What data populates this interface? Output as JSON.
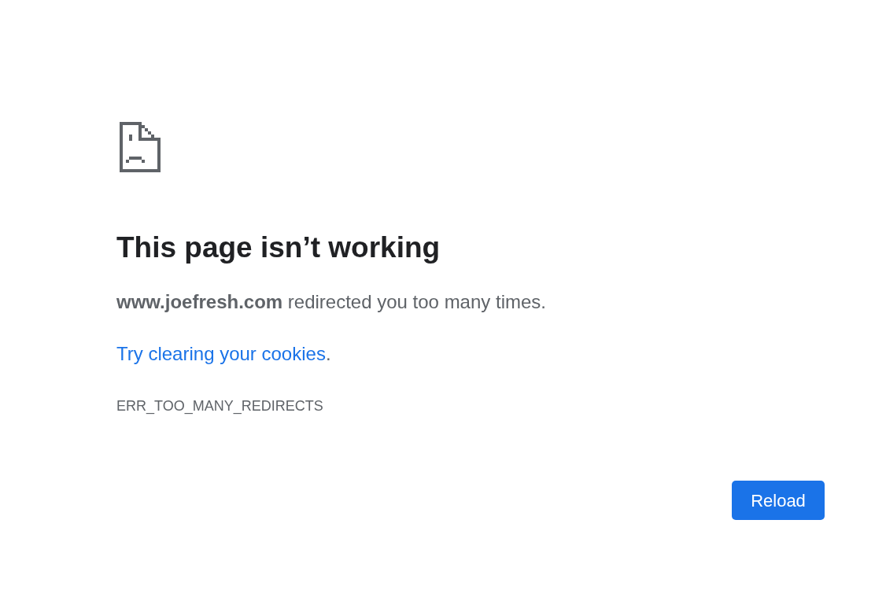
{
  "heading": "This page isn’t working",
  "message": "**www.joefresh.com** redirected you too many times.",
  "suggestion": {
    "link": "Try clearing your cookies",
    "after": "."
  },
  "error_code": "ERR_TOO_MANY_REDIRECTS",
  "buttons": [
    {
      "label": "Reload",
      "kind": "primary"
    }
  ]
}
